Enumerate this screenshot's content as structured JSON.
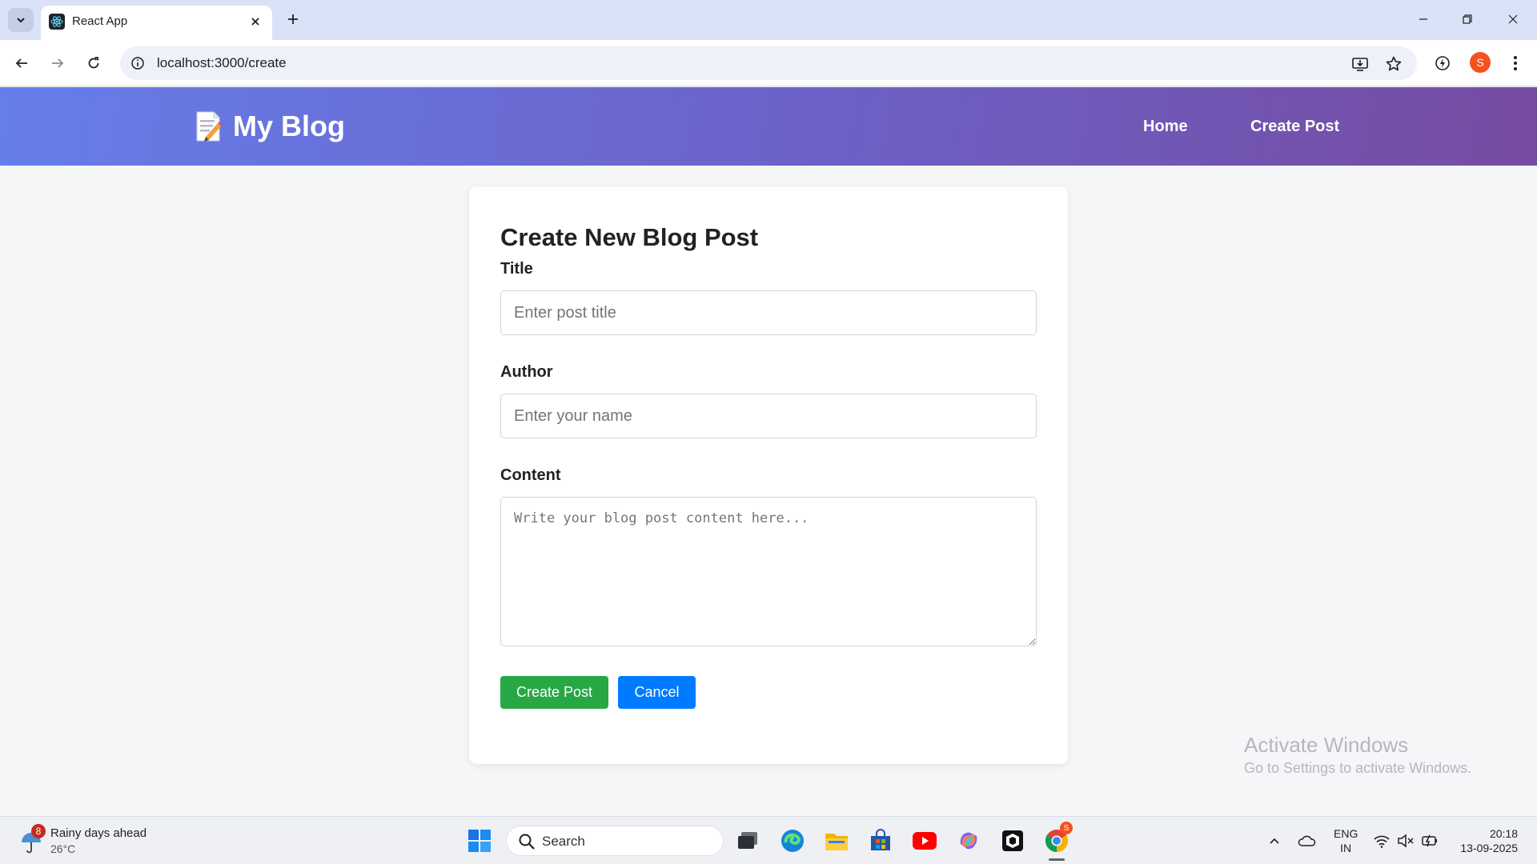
{
  "browser": {
    "tab_title": "React App",
    "url": "localhost:3000/create",
    "profile_initial": "S"
  },
  "header": {
    "brand": "My Blog",
    "brand_icon": "memo-icon",
    "nav": [
      {
        "label": "Home"
      },
      {
        "label": "Create Post"
      }
    ],
    "gradient": [
      "#667eea",
      "#764ba2"
    ]
  },
  "form": {
    "heading": "Create New Blog Post",
    "title_label": "Title",
    "title_placeholder": "Enter post title",
    "author_label": "Author",
    "author_placeholder": "Enter your name",
    "content_label": "Content",
    "content_placeholder": "Write your blog post content here...",
    "create_button": "Create Post",
    "cancel_button": "Cancel",
    "colors": {
      "create": "#28a745",
      "cancel": "#007bff"
    }
  },
  "watermark": {
    "title": "Activate Windows",
    "subtitle": "Go to Settings to activate Windows."
  },
  "taskbar": {
    "weather_badge": "8",
    "weather_title": "Rainy days ahead",
    "weather_temp": "26°C",
    "search_label": "Search",
    "chrome_badge": "S",
    "lang_line1": "ENG",
    "lang_line2": "IN",
    "time": "20:18",
    "date": "13-09-2025"
  }
}
